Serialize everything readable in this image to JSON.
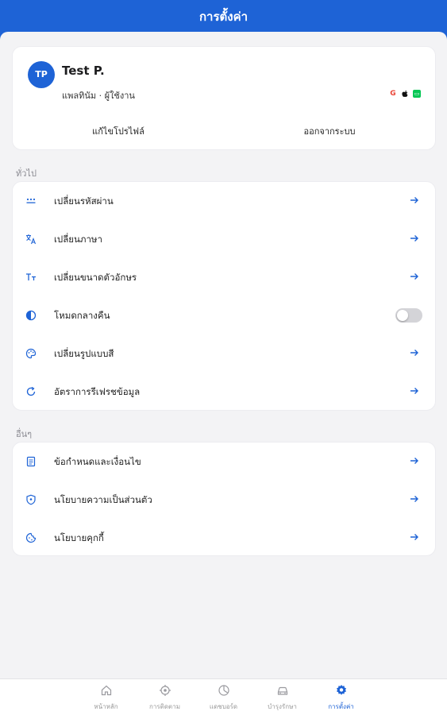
{
  "header": {
    "title": "การตั้งค่า"
  },
  "profile": {
    "initials": "TP",
    "name": "Test P.",
    "role": "แพลทินัม · ผู้ใช้งาน",
    "providers": [
      "google-icon",
      "apple-icon",
      "line-icon"
    ],
    "edit_label": "แก้ไขโปรไฟล์",
    "logout_label": "ออกจากระบบ"
  },
  "general": {
    "title": "ทั่วไป",
    "items": [
      {
        "label": "เปลี่ยนรหัสผ่าน",
        "icon": "password-icon"
      },
      {
        "label": "เปลี่ยนภาษา",
        "icon": "translate-icon"
      },
      {
        "label": "เปลี่ยนขนาดตัวอักษร",
        "icon": "text-size-icon"
      },
      {
        "label": "โหมดกลางคืน",
        "icon": "dark-mode-icon",
        "toggle": false
      },
      {
        "label": "เปลี่ยนรูปแบบสี",
        "icon": "palette-icon"
      },
      {
        "label": "อัตราการรีเฟรชข้อมูล",
        "icon": "refresh-icon"
      }
    ]
  },
  "others": {
    "title": "อื่นๆ",
    "items": [
      {
        "label": "ข้อกำหนดและเงื่อนไข",
        "icon": "document-icon"
      },
      {
        "label": "นโยบายความเป็นส่วนตัว",
        "icon": "shield-icon"
      },
      {
        "label": "นโยบายคุกกี้",
        "icon": "cookie-icon"
      }
    ]
  },
  "tabs": [
    {
      "label": "หน้าหลัก",
      "icon": "home-icon",
      "active": false
    },
    {
      "label": "การติดตาม",
      "icon": "tracking-icon",
      "active": false
    },
    {
      "label": "แดชบอร์ด",
      "icon": "dashboard-icon",
      "active": false
    },
    {
      "label": "บำรุงรักษา",
      "icon": "car-icon",
      "active": false
    },
    {
      "label": "การตั้งค่า",
      "icon": "settings-icon",
      "active": true
    }
  ],
  "colors": {
    "primary": "#1e63d6",
    "background": "#f3f3f5"
  }
}
